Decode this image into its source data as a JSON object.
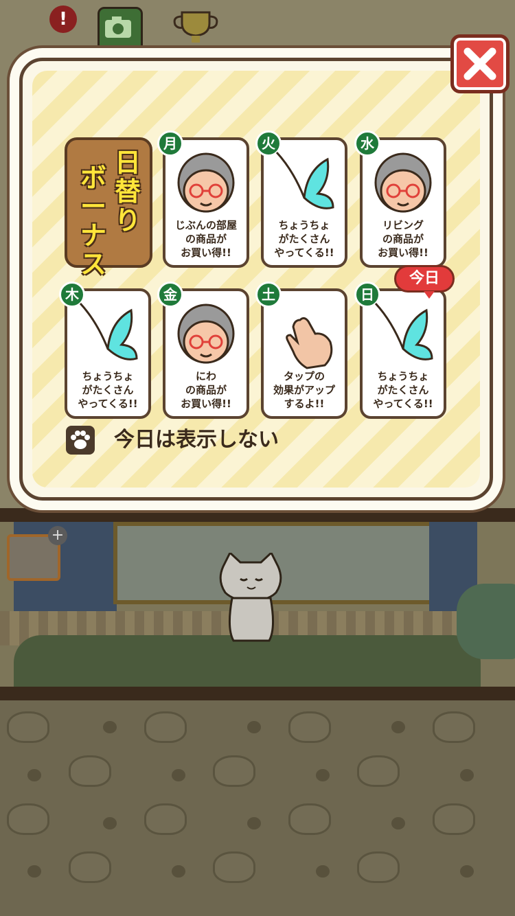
{
  "top_bar": {
    "alert_badge": "!"
  },
  "modal": {
    "title_line1": "日替り",
    "title_line2": "ボーナス",
    "today_label": "今日",
    "dont_show_label": "今日は表示しない",
    "close_icon": "close-x-icon",
    "days": [
      {
        "day": "月",
        "icon": "grandma-icon",
        "caption": "じぶんの部屋\nの商品が\nお買い得!!"
      },
      {
        "day": "火",
        "icon": "butterfly-icon",
        "caption": "ちょうちょ\nがたくさん\nやってくる!!"
      },
      {
        "day": "水",
        "icon": "grandma-icon",
        "caption": "リビング\nの商品が\nお買い得!!"
      },
      {
        "day": "木",
        "icon": "butterfly-icon",
        "caption": "ちょうちょ\nがたくさん\nやってくる!!"
      },
      {
        "day": "金",
        "icon": "grandma-icon",
        "caption": "にわ\nの商品が\nお買い得!!"
      },
      {
        "day": "土",
        "icon": "tap-hand-icon",
        "caption": "タップの\n効果がアップ\nするよ!!"
      },
      {
        "day": "日",
        "icon": "butterfly-icon",
        "caption": "ちょうちょ\nがたくさん\nやってくる!!"
      }
    ]
  },
  "colors": {
    "badge_green": "#1f7a3a",
    "close_red": "#e24a44",
    "today_red": "#e23b3b",
    "title_yellow": "#ffe53a"
  }
}
